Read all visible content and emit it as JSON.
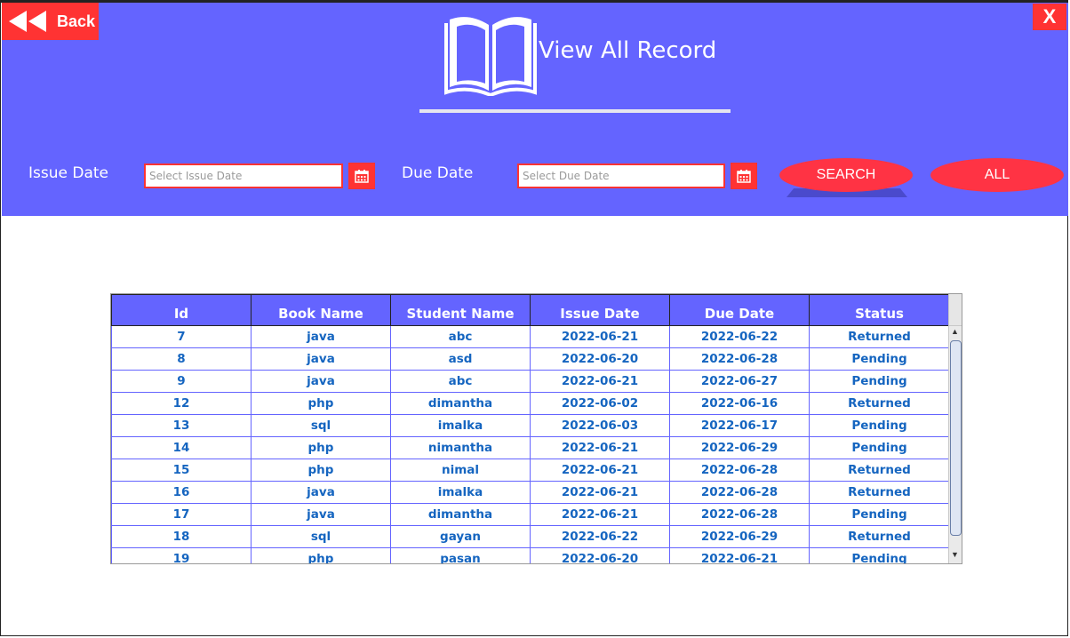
{
  "window": {
    "back_label": "Back",
    "close_label": "X",
    "title": "View All Record"
  },
  "filters": {
    "issue_date_label": "Issue Date",
    "issue_date_placeholder": "Select Issue Date",
    "due_date_label": "Due Date",
    "due_date_placeholder": "Select Due Date",
    "search_label": "SEARCH",
    "all_label": "ALL"
  },
  "colors": {
    "header_bg": "#6464ff",
    "accent_red": "#ff3333",
    "cell_text": "#1565c0"
  },
  "table": {
    "columns": [
      "Id",
      "Book Name",
      "Student Name",
      "Issue Date",
      "Due Date",
      "Status"
    ],
    "rows": [
      [
        "7",
        "java",
        "abc",
        "2022-06-21",
        "2022-06-22",
        "Returned"
      ],
      [
        "8",
        "java",
        "asd",
        "2022-06-20",
        "2022-06-28",
        "Pending"
      ],
      [
        "9",
        "java",
        "abc",
        "2022-06-21",
        "2022-06-27",
        "Pending"
      ],
      [
        "12",
        "php",
        "dimantha",
        "2022-06-02",
        "2022-06-16",
        "Returned"
      ],
      [
        "13",
        "sql",
        "imalka",
        "2022-06-03",
        "2022-06-17",
        "Pending"
      ],
      [
        "14",
        "php",
        "nimantha",
        "2022-06-21",
        "2022-06-29",
        "Pending"
      ],
      [
        "15",
        "php",
        "nimal",
        "2022-06-21",
        "2022-06-28",
        "Returned"
      ],
      [
        "16",
        "java",
        "imalka",
        "2022-06-21",
        "2022-06-28",
        "Returned"
      ],
      [
        "17",
        "java",
        "dimantha",
        "2022-06-21",
        "2022-06-28",
        "Pending"
      ],
      [
        "18",
        "sql",
        "gayan",
        "2022-06-22",
        "2022-06-29",
        "Returned"
      ],
      [
        "19",
        "php",
        "pasan",
        "2022-06-20",
        "2022-06-21",
        "Pending"
      ]
    ]
  }
}
